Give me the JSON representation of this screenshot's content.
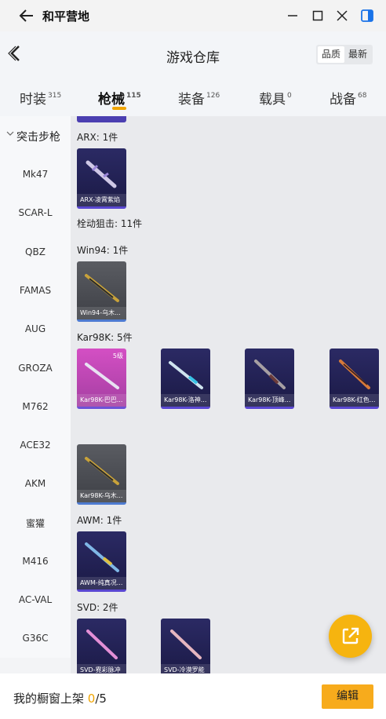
{
  "window": {
    "title": "和平营地"
  },
  "header": {
    "title": "游戏仓库",
    "sort_options": [
      "品质",
      "最新"
    ],
    "active_sort": "品质"
  },
  "tabs": [
    {
      "label": "时装",
      "count": "315"
    },
    {
      "label": "枪械",
      "count": "115"
    },
    {
      "label": "装备",
      "count": "126"
    },
    {
      "label": "载具",
      "count": "0"
    },
    {
      "label": "战备",
      "count": "68"
    }
  ],
  "sidebar": {
    "group": "突击步枪",
    "items": [
      "Mk47",
      "SCAR-L",
      "QBZ",
      "FAMAS",
      "AUG",
      "GROZA",
      "M762",
      "ACE32",
      "AKM",
      "蜜獾",
      "M416",
      "AC-VAL",
      "G36C"
    ]
  },
  "content": {
    "sections": [
      {
        "title": "ARX: 1件",
        "cards": [
          {
            "label": "ARX-凌霄紫焰",
            "style": "dark"
          }
        ]
      },
      {
        "title": "栓动狙击: 11件",
        "cards": []
      },
      {
        "title": "Win94: 1件",
        "cards": [
          {
            "label": "Win94-乌木...",
            "style": "grey"
          }
        ]
      },
      {
        "title": "Kar98K: 5件",
        "cards": [
          {
            "label": "Kar98K-巴巴...",
            "style": "pink",
            "level": "5级"
          },
          {
            "label": "Kar98K-洛神...",
            "style": "dark"
          },
          {
            "label": "Kar98K-顶峰...",
            "style": "dark"
          },
          {
            "label": "Kar98K-红色...",
            "style": "dark"
          },
          {
            "label": "Kar98K-乌木...",
            "style": "grey"
          }
        ]
      },
      {
        "title": "AWM: 1件",
        "cards": [
          {
            "label": "AWM-纯真况...",
            "style": "dark"
          }
        ]
      },
      {
        "title": "SVD: 2件",
        "cards": [
          {
            "label": "SVD-霓彩脉冲",
            "style": "dark"
          },
          {
            "label": "SVD-冷漠罗能",
            "style": "dark"
          }
        ]
      }
    ]
  },
  "bottom": {
    "label": "我的橱窗上架",
    "count": "0",
    "total": "/5",
    "edit": "编辑"
  },
  "colors": {
    "accent": "#f0a400",
    "fab": "#f6b40f",
    "card_dark": "#1b1a46",
    "card_pink": "#d44fc4"
  }
}
